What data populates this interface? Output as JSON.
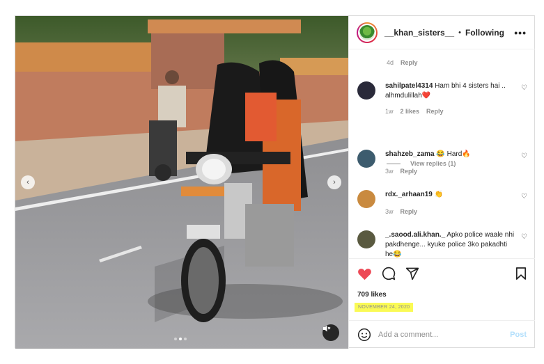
{
  "post": {
    "username": "__khan_sisters__",
    "separator": "•",
    "follow_status": "Following",
    "more_label": "•••"
  },
  "media": {
    "prev_arrow": "‹",
    "next_arrow": "›",
    "slide_count": 3,
    "active_slide": 2
  },
  "comments": {
    "first_meta": {
      "time": "4d",
      "reply": "Reply"
    },
    "items": [
      {
        "user": "sahilpatel4314",
        "text": "Ham bhi 4 sisters hai .. alhmdulillah❤️",
        "time": "1w",
        "likes": "2 likes",
        "reply": "Reply",
        "avatar_color": "#2a2a3a"
      },
      {
        "user": "shahzeb_zama",
        "text": "😂 Hard🔥",
        "time": "3w",
        "likes": "",
        "reply": "Reply",
        "avatar_color": "#3d5c6e"
      },
      {
        "user": "rdx._arhaan19",
        "text": "👏",
        "time": "3w",
        "likes": "",
        "reply": "Reply",
        "avatar_color": "#c98a3f"
      },
      {
        "user": "_.saood.ali.khan._",
        "text": "Apko police waale nhi pakdhenge... kyuke police 3ko pakadhti he😂",
        "time": "",
        "likes": "",
        "reply": "",
        "avatar_color": "#5a5a40"
      }
    ],
    "view_replies": "View replies (1)"
  },
  "actions": {
    "likes": "709 likes",
    "date": "NOVEMBER 24, 2020"
  },
  "add_comment": {
    "placeholder": "Add a comment...",
    "post_label": "Post"
  },
  "icons": [
    "heart-icon",
    "comment-icon",
    "share-icon",
    "bookmark-icon",
    "emoji-icon",
    "mute-icon",
    "avatar-icon"
  ],
  "colors": {
    "like_red": "#ed4956",
    "highlight": "#fafa55",
    "post_disabled": "#b2dffc"
  }
}
